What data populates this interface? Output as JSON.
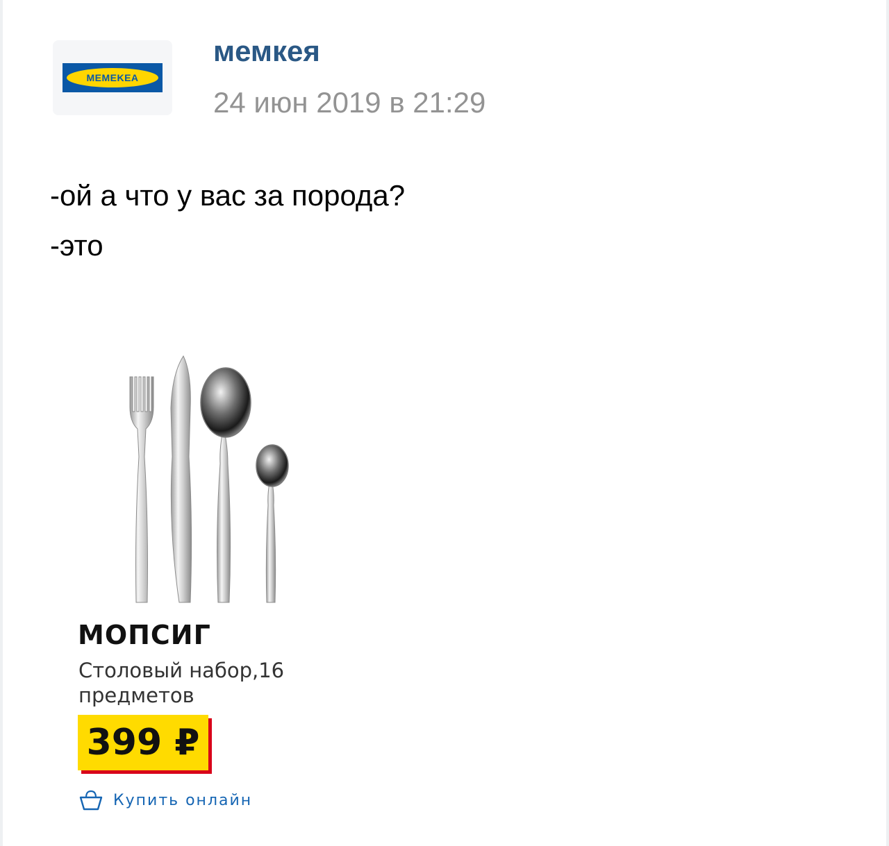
{
  "post": {
    "author": "мемкея",
    "timestamp": "24 июн 2019 в 21:29",
    "avatar_logo_text": "MEMEKEA",
    "text_lines": [
      "-ой а что у вас за порода?",
      "-это"
    ]
  },
  "product": {
    "name": "МОПСИГ",
    "description_lines": [
      "Столовый набор,16",
      "предметов"
    ],
    "price": "399 ₽",
    "buy_label": "Купить онлайн"
  },
  "colors": {
    "author": "#2a5885",
    "timestamp": "#939393",
    "price_bg": "#ffdb00",
    "price_shadow": "#d8001a",
    "logo_blue": "#0a58a6",
    "logo_yellow": "#ffd500",
    "link": "#1565b3"
  },
  "icons": {
    "buy": "shopping-basket-icon"
  }
}
